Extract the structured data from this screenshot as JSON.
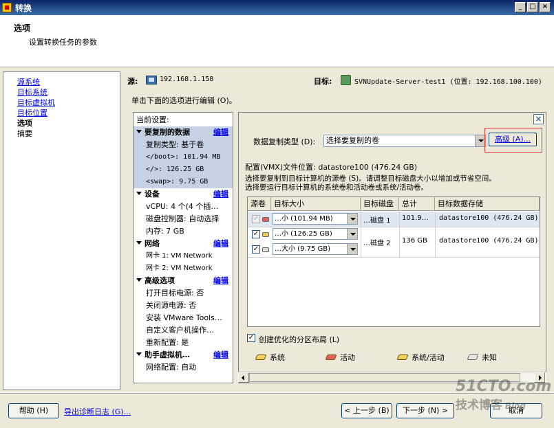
{
  "window": {
    "title": "转换"
  },
  "header": {
    "title": "选项",
    "subtitle": "设置转换任务的参数"
  },
  "nav": {
    "items": [
      "源系统",
      "目标系统",
      "目标虚拟机",
      "目标位置",
      "选项",
      "摘要"
    ]
  },
  "source": {
    "label": "源:",
    "value": "192.168.1.158"
  },
  "target": {
    "label": "目标:",
    "value": "SVNUpdate-Server-test1 (位置: 192.168.100.100)"
  },
  "instruction": "单击下面的选项进行编辑 (O)。",
  "settings": {
    "header": "当前设置:",
    "edit_label": "编辑",
    "groups": [
      {
        "title": "要复制的数据",
        "items": [
          "复制类型: 基于卷",
          "</boot>: 101.94 MB",
          "</>: 126.25 GB",
          "<swap>: 9.75 GB"
        ]
      },
      {
        "title": "设备",
        "items": [
          "vCPU: 4 个(4 个插…",
          "磁盘控制器: 自动选择",
          "内存: 7 GB"
        ]
      },
      {
        "title": "网络",
        "items": [
          "网卡 1: VM Network",
          "网卡 2: VM Network"
        ]
      },
      {
        "title": "高级选项",
        "items": [
          "打开目标电源: 否",
          "关闭源电源: 否",
          "安装 VMware Tools…",
          "自定义客户机操作…",
          "重新配置: 是"
        ]
      },
      {
        "title": "助手虚拟机…",
        "items": [
          "网络配置: 自动"
        ]
      }
    ]
  },
  "detail": {
    "copy_type_label": "数据复制类型 (D):",
    "copy_type_value": "选择要复制的卷",
    "advanced_button": "高级 (A)...",
    "config_location": "配置(VMX)文件位置: datastore100 (476.24 GB)",
    "hint_line1": "选择要复制到目标计算机的源卷 (S)。请调整目标磁盘大小以增加或节省空间。",
    "hint_line2": "选择要运行目标计算机的系统卷和活动卷或系统/活动卷。",
    "table": {
      "columns": [
        "源卷",
        "目标大小",
        "目标磁盘",
        "总计",
        "目标数据存储"
      ],
      "rows": [
        {
          "size": "…小 (101.94 MB)",
          "disk": "…磁盘 1",
          "total": "101.9…",
          "store": "datastore100 (476.24 GB)",
          "icon_color": "#e06060"
        },
        {
          "size": "…小 (126.25 GB)",
          "disk": "…磁盘 2",
          "total": "136 GB",
          "store": "datastore100 (476.24 GB)",
          "icon_color": "#f0d060"
        },
        {
          "size": "…大小 (9.75 GB)",
          "icon_color": "#e0e0e0"
        }
      ]
    },
    "optimize_label": "创建优化的分区布局 (L)",
    "legend": [
      "系统",
      "活动",
      "系统/活动",
      "未知"
    ]
  },
  "buttons": {
    "help": "帮助 (H)",
    "export": "导出诊断日志 (G)...",
    "back": "< 上一步 (B)",
    "next": "下一步 (N) >",
    "cancel": "取消"
  },
  "watermark": {
    "line1": "51CTO.com",
    "line2": "技术博客",
    "line3": "Blog"
  },
  "colors": {
    "title_bar": "#0a246a",
    "link": "#0000ee",
    "selection": "#c5d2e6",
    "highlight_frame": "#e03030"
  }
}
